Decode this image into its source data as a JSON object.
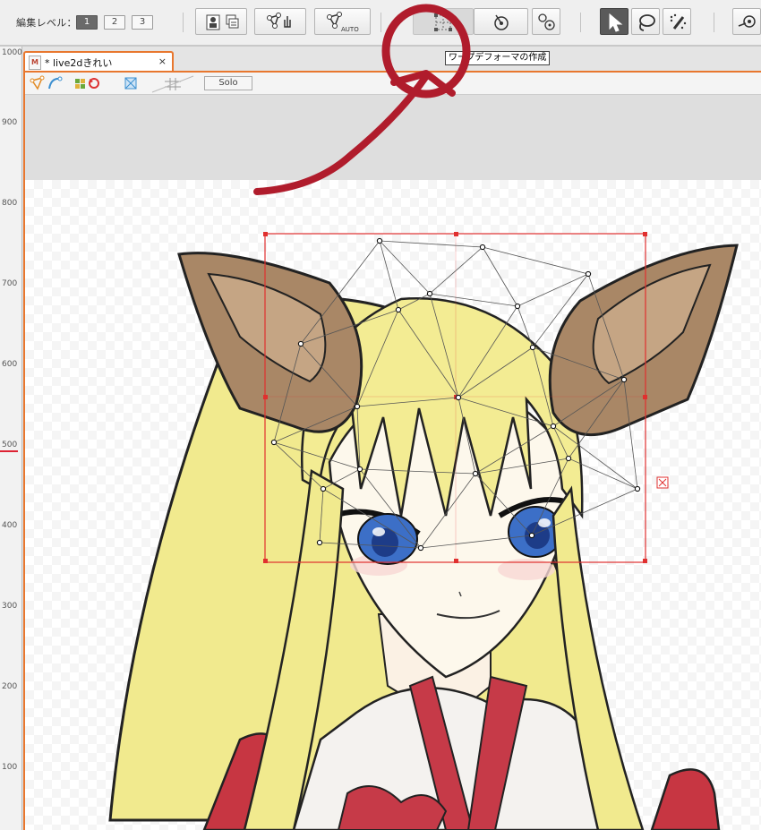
{
  "toolbar": {
    "edit_level_label": "編集レベル：",
    "levels": [
      "1",
      "2",
      "3"
    ],
    "auto_label": "AUTO"
  },
  "tooltip": "ワープデフォーマの作成",
  "ruler": {
    "labels": [
      "1000",
      "900",
      "800",
      "700",
      "600",
      "500",
      "400",
      "300",
      "200",
      "100"
    ]
  },
  "document_tab": {
    "icon": "M",
    "title": "* live2dきれい",
    "close": "×"
  },
  "subtoolbar": {
    "solo_label": "Solo"
  },
  "colors": {
    "accent": "#e8772e",
    "deformer": "#e0302f",
    "annotation": "#b01c2c",
    "hair": "#f3ec93",
    "ear": "#a98766",
    "eye": "#3c6fc7"
  }
}
